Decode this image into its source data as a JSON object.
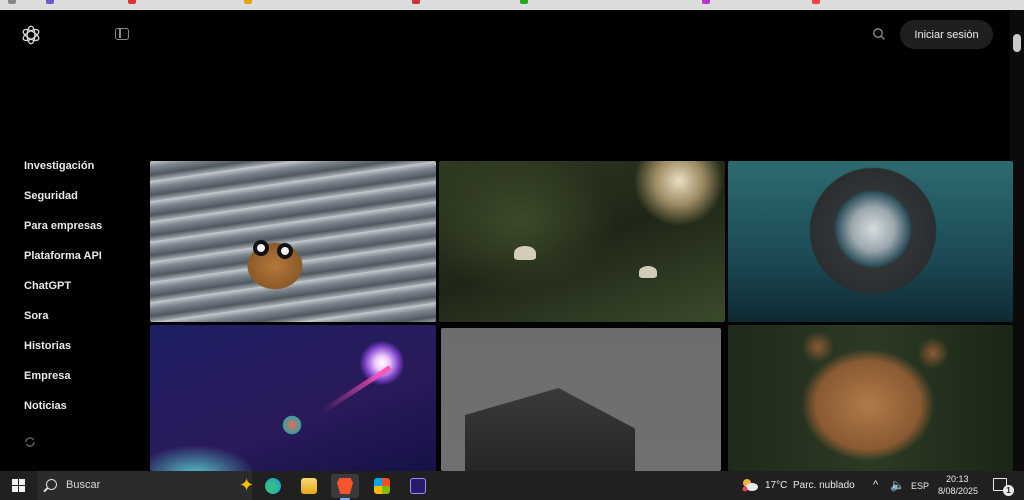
{
  "header": {
    "logo_icon": "openai-logo-icon",
    "sidebar_toggle_icon": "sidebar-toggle-icon",
    "search_icon": "search-icon",
    "login_label": "Iniciar sesión"
  },
  "sidebar": {
    "items": [
      {
        "label": "Investigación"
      },
      {
        "label": "Seguridad"
      },
      {
        "label": "Para empresas"
      },
      {
        "label": "Plataforma API"
      },
      {
        "label": "ChatGPT"
      },
      {
        "label": "Sora"
      },
      {
        "label": "Historias"
      },
      {
        "label": "Empresa"
      },
      {
        "label": "Noticias"
      }
    ],
    "extra_icon": "refresh-icon"
  },
  "gallery": {
    "tiles": [
      {
        "icon": "image-creature-in-surf"
      },
      {
        "icon": "image-jellyfish-in-forest"
      },
      {
        "icon": "image-astronaut-underwater"
      },
      {
        "icon": "image-space-comet"
      },
      {
        "icon": "image-building-fog"
      },
      {
        "icon": "image-bear-in-forest"
      }
    ]
  },
  "taskbar": {
    "search_placeholder": "Buscar",
    "apps": [
      {
        "name": "copilot",
        "color": "#f2c200"
      },
      {
        "name": "edge",
        "color": "#1a9be0"
      },
      {
        "name": "file-explorer",
        "color": "#f0c040"
      },
      {
        "name": "brave",
        "color": "#fb542b"
      },
      {
        "name": "microsoft-store",
        "color": "#3a96dd"
      },
      {
        "name": "premiere-pro",
        "color": "#2a1a6a"
      }
    ],
    "temperature": "17°C",
    "weather": "Parc. nublado",
    "language": "ESP",
    "time": "20:13",
    "date": "8/08/2025",
    "notifications": "1"
  },
  "colors": {
    "background": "#000000",
    "login_button": "#1f1f1f",
    "taskbar": "#202020"
  }
}
